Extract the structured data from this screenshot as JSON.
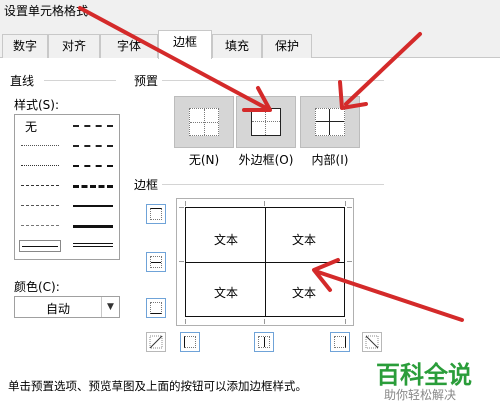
{
  "dialog": {
    "title": "设置单元格格式"
  },
  "tabs": [
    {
      "label": "数字"
    },
    {
      "label": "对齐"
    },
    {
      "label": "字体"
    },
    {
      "label": "边框",
      "active": true
    },
    {
      "label": "填充"
    },
    {
      "label": "保护"
    }
  ],
  "line": {
    "group_label": "直线",
    "style_label": "样式(S):",
    "none_label": "无",
    "color_label": "颜色(C):",
    "color_value": "自动"
  },
  "presets": {
    "group_label": "预置",
    "items": [
      {
        "label": "无(N)"
      },
      {
        "label": "外边框(O)"
      },
      {
        "label": "内部(I)"
      }
    ]
  },
  "border": {
    "group_label": "边框",
    "cells": [
      "文本",
      "文本",
      "文本",
      "文本"
    ]
  },
  "footer_text": "单击预置选项、预览草图及上面的按钮可以添加边框样式。",
  "watermark": {
    "main": "百科全说",
    "sub": "助你轻松解决"
  },
  "colors": {
    "arrow": "#d42a2a",
    "button_border": "#6fa3d8",
    "watermark": "#2a9d3a"
  }
}
